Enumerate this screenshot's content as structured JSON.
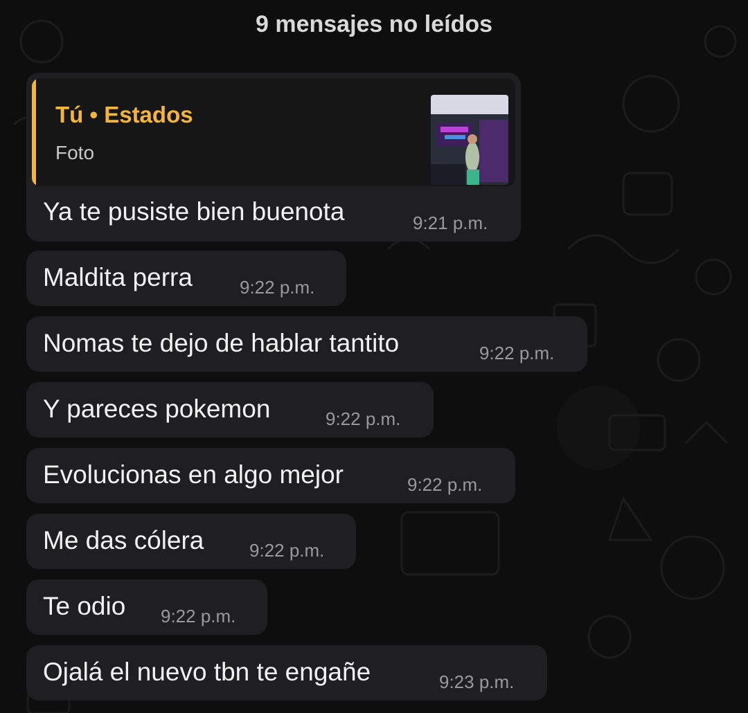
{
  "banner": {
    "unread": "9 mensajes no leídos"
  },
  "quoted": {
    "author": "Tú • Estados",
    "type": "Foto"
  },
  "messages": [
    {
      "text": "Ya te pusiste bien buenota",
      "time": "9:21 p.m."
    },
    {
      "text": "Maldita perra",
      "time": "9:22 p.m."
    },
    {
      "text": "Nomas te dejo de hablar tantito",
      "time": "9:22 p.m."
    },
    {
      "text": "Y pareces pokemon",
      "time": "9:22 p.m."
    },
    {
      "text": "Evolucionas en algo mejor",
      "time": "9:22 p.m."
    },
    {
      "text": "Me das cólera",
      "time": "9:22 p.m."
    },
    {
      "text": "Te odio",
      "time": "9:22 p.m."
    },
    {
      "text": "Ojalá el nuevo tbn te engañe",
      "time": "9:23 p.m."
    }
  ],
  "colors": {
    "accent": "#f5b53a",
    "bubble": "#1f1f21",
    "background": "#0e0e0e"
  }
}
